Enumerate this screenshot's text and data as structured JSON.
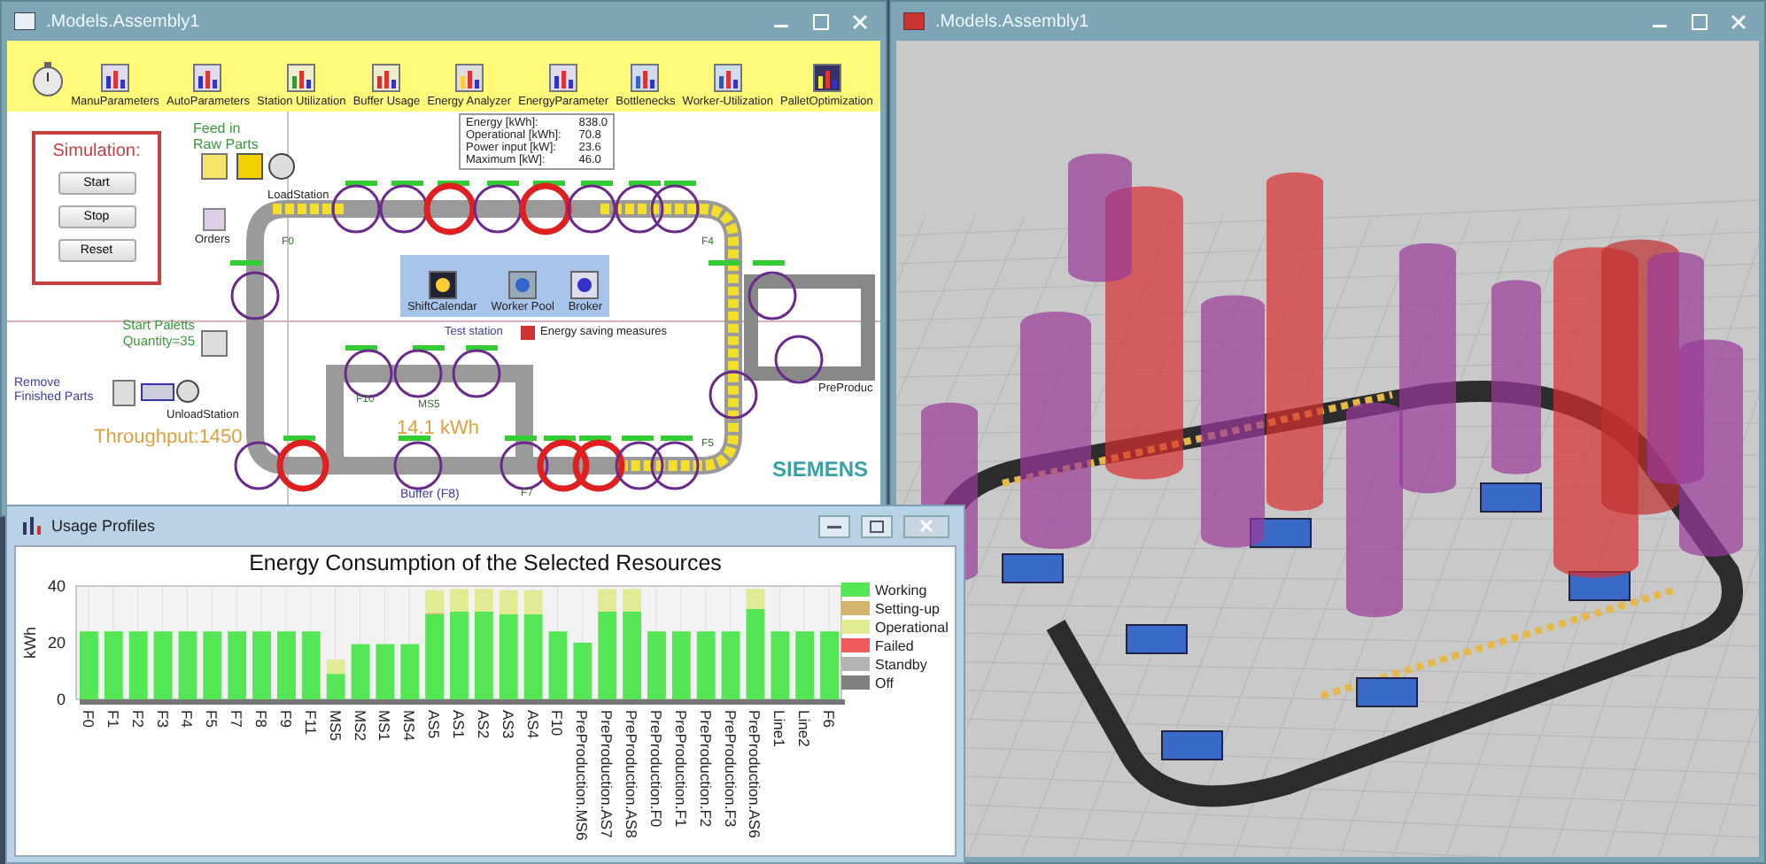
{
  "model_window": {
    "title": ".Models.Assembly1",
    "toolbar": [
      "ManuParameters",
      "AutoParameters",
      "Station Utilization",
      "Buffer Usage",
      "Energy Analyzer",
      "EnergyParameter",
      "Bottlenecks",
      "Worker-Utilization",
      "PalletOptimization"
    ],
    "simulation": {
      "title": "Simulation:",
      "buttons": [
        "Start",
        "Stop",
        "Reset"
      ]
    },
    "canvas": {
      "feed_label": "Feed in Raw Parts",
      "load_station": "LoadStation",
      "orders": "Orders",
      "start_paletts": "Start Paletts Quantity=35",
      "remove_label": "Remove Finished Parts",
      "unload_station": "UnloadStation",
      "throughput": "Throughput:1450",
      "energy_total": "14.1 kWh",
      "buffer": "Buffer (F8)",
      "test_station": "Test station",
      "pre_production": "PreProduc",
      "energy_saving": "Energy saving measures",
      "brand": "SIEMENS",
      "resources_panel": [
        "ShiftCalendar",
        "Worker Pool",
        "Broker"
      ],
      "energy_tooltip": [
        {
          "label": "Energy [kWh]:",
          "value": "838.0"
        },
        {
          "label": "Operational [kWh]:",
          "value": "70.8"
        },
        {
          "label": "Power input [kW]:",
          "value": "23.6"
        },
        {
          "label": "Maximum [kW]:",
          "value": "46.0"
        }
      ],
      "station_labels": [
        "F0",
        "F4",
        "F5",
        "F7",
        "F10",
        "MS5"
      ],
      "stations": [
        {
          "highlighted": false
        },
        {
          "highlighted": false
        },
        {
          "highlighted": true
        },
        {
          "highlighted": false
        },
        {
          "highlighted": true
        },
        {
          "highlighted": false
        },
        {
          "highlighted": false
        },
        {
          "highlighted": false
        },
        {
          "highlighted": false
        },
        {
          "highlighted": false
        },
        {
          "highlighted": false
        },
        {
          "highlighted": false
        },
        {
          "highlighted": false
        },
        {
          "highlighted": false
        },
        {
          "highlighted": false
        },
        {
          "highlighted": true
        },
        {
          "highlighted": false
        },
        {
          "highlighted": false
        },
        {
          "highlighted": true
        },
        {
          "highlighted": true
        },
        {
          "highlighted": false
        },
        {
          "highlighted": false
        },
        {
          "highlighted": false
        }
      ]
    }
  },
  "view_3d_window": {
    "title": ".Models.Assembly1"
  },
  "usage_window": {
    "title": "Usage Profiles",
    "chart_data": {
      "type": "bar",
      "title": "Energy Consumption of the Selected Resources",
      "ylabel": "kWh",
      "stacked": true,
      "orientation": "vertical",
      "categories": [
        "F0",
        "F1",
        "F2",
        "F3",
        "F4",
        "F5",
        "F7",
        "F8",
        "F9",
        "F11",
        "MS5",
        "MS2",
        "MS1",
        "MS4",
        "AS5",
        "AS1",
        "AS2",
        "AS3",
        "AS4",
        "F10",
        "PreProduction.MS6",
        "PreProduction.AS7",
        "PreProduction.AS8",
        "PreProduction.F0",
        "PreProduction.F1",
        "PreProduction.F2",
        "PreProduction.F3",
        "PreProduction.AS6",
        "Line1",
        "Line2",
        "F6"
      ],
      "series": [
        {
          "name": "Working",
          "color": "#55e655",
          "values": [
            24,
            24,
            24,
            24,
            24,
            24,
            24,
            24,
            24,
            24,
            9,
            19.5,
            19.5,
            19.5,
            30,
            31,
            31,
            30,
            30,
            24,
            20,
            31,
            31,
            24,
            24,
            24,
            24,
            32,
            24,
            24,
            24
          ]
        },
        {
          "name": "Setting-up",
          "color": "#d2b46c",
          "values": [
            0,
            0,
            0,
            0,
            0,
            0,
            0,
            0,
            0,
            0,
            0,
            0,
            0,
            0,
            0.5,
            0,
            0,
            0,
            0,
            0,
            0,
            0,
            0,
            0,
            0,
            0,
            0,
            0,
            0,
            0,
            0
          ]
        },
        {
          "name": "Operational",
          "color": "#e2ea94",
          "values": [
            0,
            0,
            0,
            0,
            0,
            0,
            0,
            0,
            0,
            0,
            5,
            0,
            0,
            0,
            8,
            8,
            8,
            8.5,
            8.5,
            0,
            0,
            8,
            8,
            0,
            0,
            0,
            0,
            7,
            0,
            0,
            0
          ]
        },
        {
          "name": "Failed",
          "color": "#f05a5a",
          "values": [
            0,
            0,
            0,
            0,
            0,
            0,
            0,
            0,
            0,
            0,
            0,
            0,
            0,
            0,
            0,
            0,
            0,
            0,
            0,
            0,
            0,
            0,
            0,
            0,
            0,
            0,
            0,
            0,
            0,
            0,
            0
          ]
        },
        {
          "name": "Standby",
          "color": "#b4b4b4",
          "values": [
            0,
            0,
            0,
            0,
            0,
            0,
            0,
            0,
            0,
            0,
            0,
            0,
            0,
            0,
            0,
            0,
            0,
            0,
            0,
            0,
            0,
            0,
            0,
            0,
            0,
            0,
            0,
            0,
            0,
            0,
            0
          ]
        },
        {
          "name": "Off",
          "color": "#808080",
          "values": [
            0,
            0,
            0,
            0,
            0,
            0,
            0,
            0,
            0,
            0,
            0,
            0,
            0,
            0,
            0,
            0,
            0,
            0,
            0,
            0,
            0,
            0,
            0,
            0,
            0,
            0,
            0,
            0,
            0,
            0,
            0
          ]
        }
      ],
      "ylim": [
        0,
        40
      ],
      "yticks": [
        0,
        20,
        40
      ],
      "grid": true,
      "legend": true
    }
  }
}
